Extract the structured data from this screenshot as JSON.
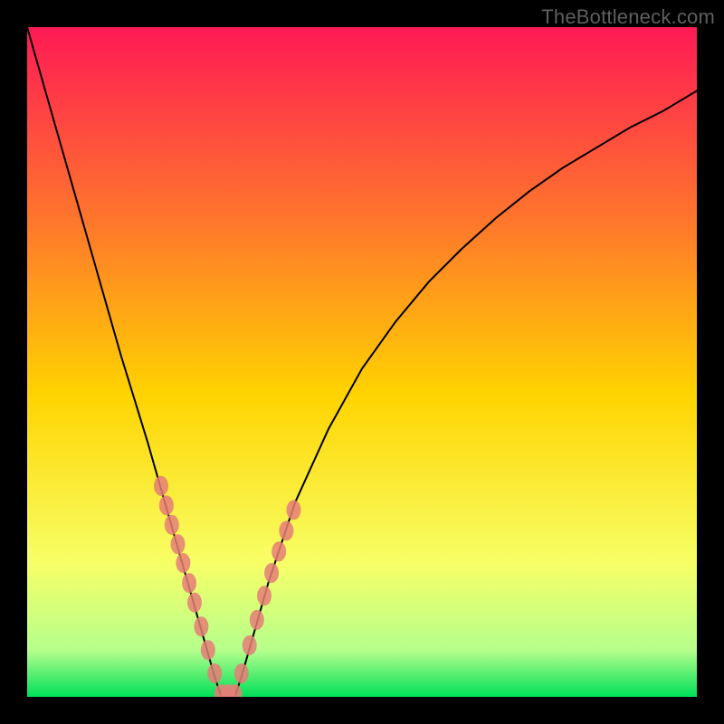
{
  "watermark": "TheBottleneck.com",
  "chart_data": {
    "type": "line",
    "title": "",
    "xlabel": "",
    "ylabel": "",
    "xlim": [
      0,
      100
    ],
    "ylim": [
      0,
      100
    ],
    "grid": false,
    "series": [
      {
        "name": "curve",
        "x": [
          0,
          2,
          4,
          6,
          8,
          10,
          12,
          14,
          16,
          18,
          20,
          22,
          24,
          26,
          28,
          29,
          30,
          31,
          32,
          34,
          36,
          40,
          45,
          50,
          55,
          60,
          65,
          70,
          75,
          80,
          85,
          90,
          95,
          100
        ],
        "y": [
          100,
          93,
          86,
          79,
          72,
          65,
          58,
          51,
          44.5,
          38,
          31,
          24,
          17,
          10,
          3,
          0,
          0,
          0,
          3,
          10,
          17,
          29,
          40,
          49,
          56,
          62,
          67,
          71.5,
          75.5,
          79,
          82,
          85,
          87.5,
          90.5
        ]
      }
    ],
    "markers": {
      "name": "highlight-points",
      "x": [
        20.0,
        20.8,
        21.6,
        22.5,
        23.3,
        24.2,
        25.0,
        26.0,
        27.0,
        28.0,
        29.0,
        30.0,
        31.0,
        32.0,
        33.2,
        34.3,
        35.4,
        36.5,
        37.6,
        38.7,
        39.8
      ],
      "y": [
        31.5,
        28.6,
        25.7,
        22.8,
        20.0,
        17.0,
        14.1,
        10.5,
        7.0,
        3.5,
        0.4,
        0.4,
        0.4,
        3.5,
        7.7,
        11.5,
        15.1,
        18.5,
        21.7,
        24.8,
        27.9
      ]
    },
    "background_gradient": {
      "top": "#ff1a55",
      "mid_upper": "#ff7a2a",
      "mid": "#ffd400",
      "mid_lower": "#f7ff66",
      "band": "#b6ff8c",
      "bottom": "#00e059"
    }
  }
}
